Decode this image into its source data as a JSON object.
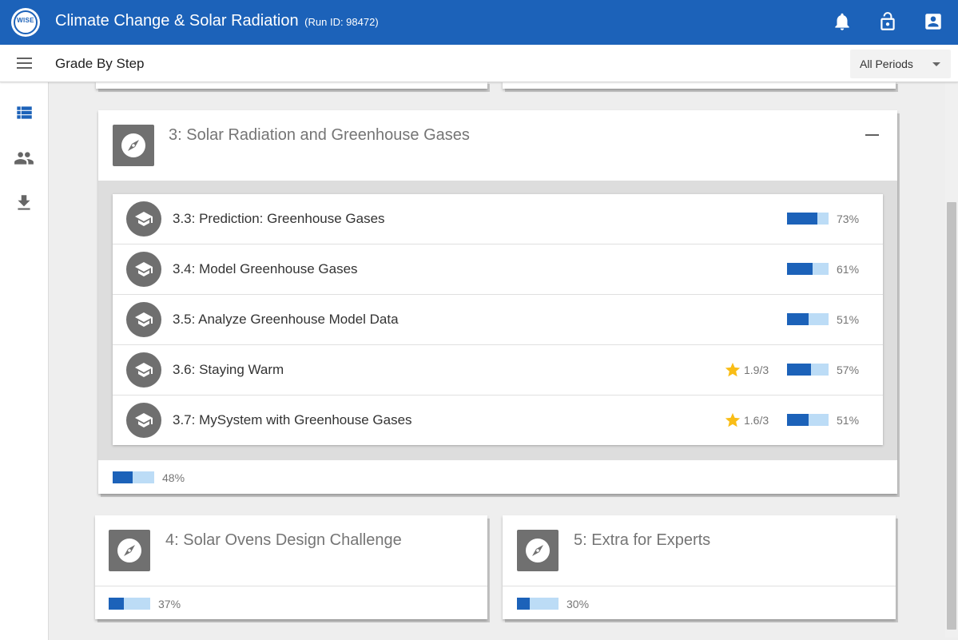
{
  "app": {
    "logo_text": "WISE",
    "title": "Climate Change & Solar Radiation",
    "run_id": "(Run ID: 98472)"
  },
  "header_icons": [
    "bell-icon",
    "lock-icon",
    "account-box-icon"
  ],
  "toolbar": {
    "page_title": "Grade By Step",
    "period_select": "All Periods"
  },
  "sidenav": [
    "list-view-icon",
    "people-icon",
    "download-icon"
  ],
  "expanded_lesson": {
    "title": "3: Solar Radiation and Greenhouse Gases",
    "progress_pct": 48,
    "progress_label": "48%",
    "steps": [
      {
        "title": "3.3: Prediction: Greenhouse Gases",
        "score": "",
        "progress_pct": 73,
        "progress_label": "73%"
      },
      {
        "title": "3.4: Model Greenhouse Gases",
        "score": "",
        "progress_pct": 61,
        "progress_label": "61%"
      },
      {
        "title": "3.5: Analyze Greenhouse Model Data",
        "score": "",
        "progress_pct": 51,
        "progress_label": "51%"
      },
      {
        "title": "3.6: Staying Warm",
        "score": "1.9/3",
        "progress_pct": 57,
        "progress_label": "57%"
      },
      {
        "title": "3.7: MySystem with Greenhouse Gases",
        "score": "1.6/3",
        "progress_pct": 51,
        "progress_label": "51%"
      }
    ]
  },
  "lessons": [
    {
      "title": "4: Solar Ovens Design Challenge",
      "progress_pct": 37,
      "progress_label": "37%"
    },
    {
      "title": "5: Extra for Experts",
      "progress_pct": 30,
      "progress_label": "30%"
    }
  ],
  "colors": {
    "primary": "#1c62b9",
    "progress_track": "#bcdcf6",
    "star": "#f9bd16",
    "icon_grey": "#707070"
  }
}
